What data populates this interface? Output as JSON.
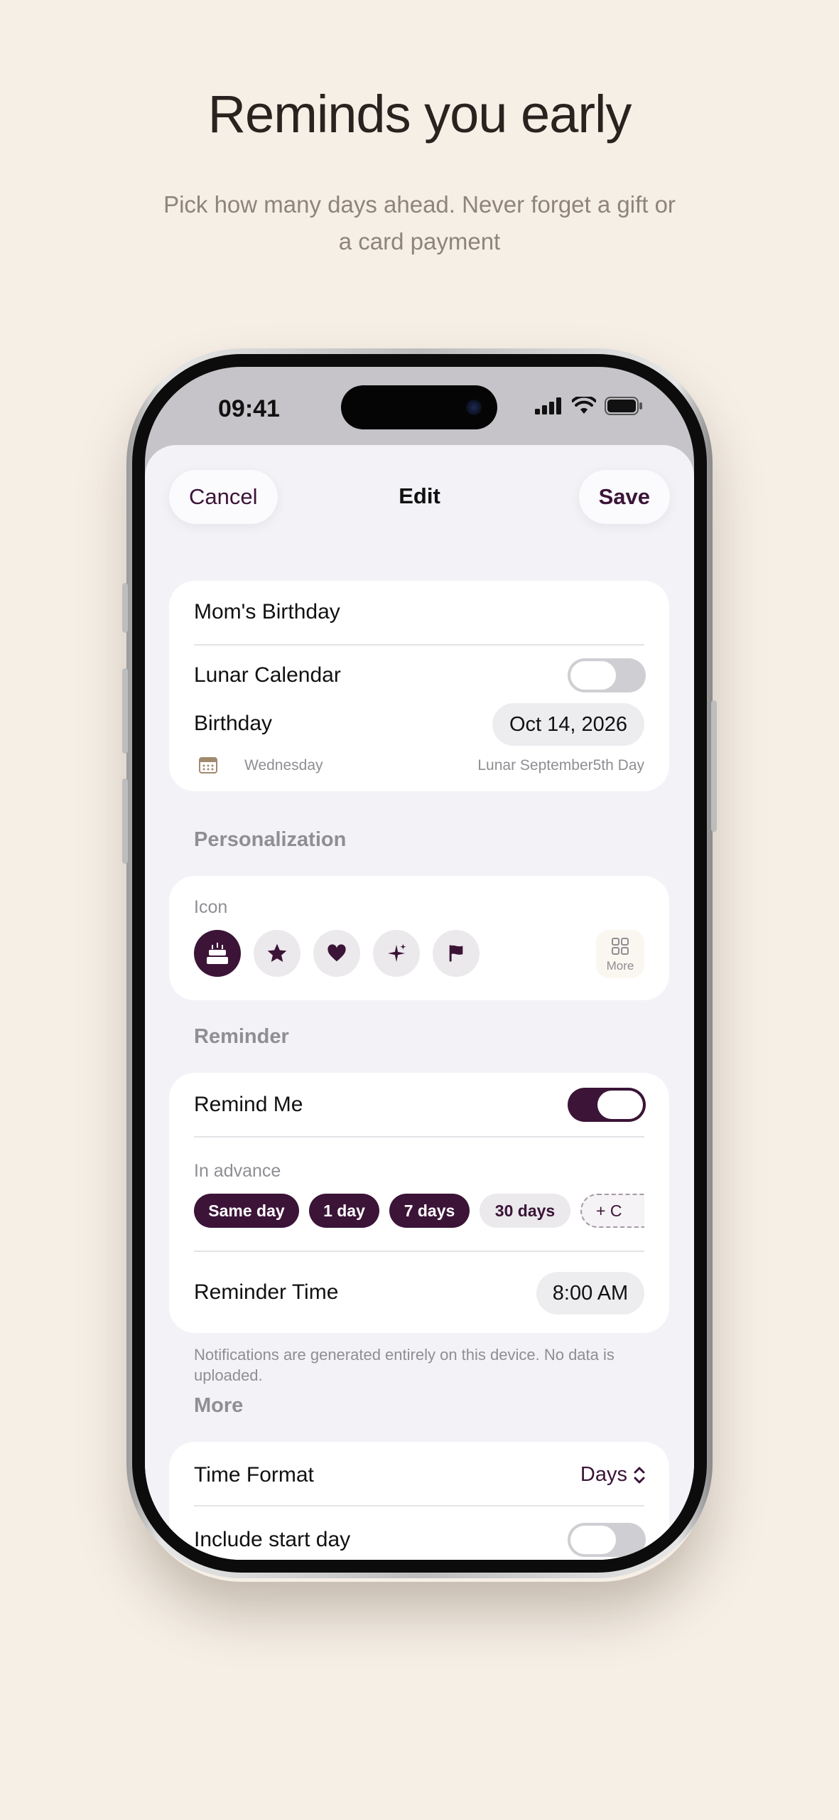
{
  "promo": {
    "headline": "Reminds you early",
    "subline": "Pick how many days ahead. Never forget a gift or a card payment"
  },
  "status_bar": {
    "time": "09:41"
  },
  "nav": {
    "cancel_label": "Cancel",
    "title": "Edit",
    "save_label": "Save"
  },
  "details": {
    "name_value": "Mom's Birthday",
    "lunar_label": "Lunar Calendar",
    "lunar_on": false,
    "date_label": "Birthday",
    "date_value": "Oct 14, 2026",
    "weekday": "Wednesday",
    "lunar_date": "Lunar September5th Day"
  },
  "personalization": {
    "section_title": "Personalization",
    "icon_label": "Icon",
    "icons": [
      "cake-icon",
      "star-icon",
      "heart-icon",
      "sparkles-icon",
      "flag-icon"
    ],
    "selected_icon": "cake-icon",
    "more_label": "More"
  },
  "reminder": {
    "section_title": "Reminder",
    "remind_label": "Remind Me",
    "remind_on": true,
    "advance_label": "In advance",
    "chips": [
      {
        "label": "Same day",
        "selected": true
      },
      {
        "label": "1 day",
        "selected": true
      },
      {
        "label": "7 days",
        "selected": true
      },
      {
        "label": "30 days",
        "selected": false
      }
    ],
    "custom_chip_label": "+ C",
    "time_label": "Reminder Time",
    "time_value": "8:00 AM",
    "footnote": "Notifications are generated entirely on this device. No data is uploaded."
  },
  "more": {
    "section_title": "More",
    "format_label": "Time Format",
    "format_value": "Days",
    "start_day_label": "Include start day",
    "start_day_on": false
  },
  "colors": {
    "accent": "#3b1437",
    "page_background": "#f6efe6",
    "sheet_background": "#f2f2f7"
  }
}
